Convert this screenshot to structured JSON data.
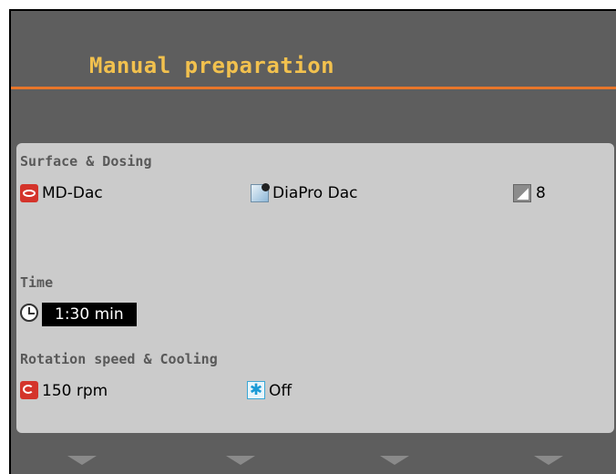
{
  "header": {
    "title": "Manual preparation"
  },
  "surface_dosing": {
    "label": "Surface & Dosing",
    "surface": {
      "value": "MD-Dac",
      "icon": "surface-disc-icon"
    },
    "dosing": {
      "value": "DiaPro Dac",
      "icon": "dosing-bottle-icon"
    },
    "level": {
      "value": "8",
      "icon": "signal-level-icon"
    }
  },
  "time": {
    "label": "Time",
    "value": "1:30 min",
    "icon": "clock-icon"
  },
  "rotation_cooling": {
    "label": "Rotation speed & Cooling",
    "rotation": {
      "value": "150 rpm",
      "icon": "rotation-icon"
    },
    "cooling": {
      "value": "Off",
      "icon": "snowflake-icon"
    }
  },
  "colors": {
    "title": "#f2c14e",
    "accent_rule": "#e8762a",
    "panel": "#cbcbcb",
    "background": "#5e5e5e"
  }
}
